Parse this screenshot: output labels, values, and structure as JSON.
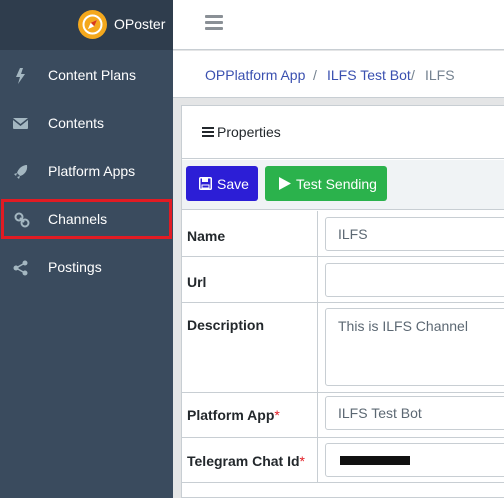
{
  "app": {
    "name": "OPoster"
  },
  "sidebar": {
    "items": [
      {
        "label": "Content Plans",
        "icon": "bolt-icon"
      },
      {
        "label": "Contents",
        "icon": "envelope-icon"
      },
      {
        "label": "Platform Apps",
        "icon": "rocket-icon"
      },
      {
        "label": "Channels",
        "icon": "link-icon"
      },
      {
        "label": "Postings",
        "icon": "share-icon"
      }
    ],
    "highlight_color": "#e21b23"
  },
  "breadcrumb": {
    "items": [
      "OPPlatform App",
      "ILFS Test Bot"
    ],
    "current": "ILFS",
    "separator": "/"
  },
  "card": {
    "header": "Properties",
    "buttons": {
      "save": "Save",
      "test": "Test Sending"
    },
    "fields": {
      "name": {
        "label": "Name",
        "value": "ILFS"
      },
      "url": {
        "label": "Url",
        "value": ""
      },
      "description": {
        "label": "Description",
        "value": "This is ILFS Channel"
      },
      "platform_app": {
        "label": "Platform App",
        "value": "ILFS Test Bot",
        "required": "*"
      },
      "telegram_chat_id": {
        "label": "Telegram Chat Id",
        "value": "",
        "required": "*"
      }
    }
  },
  "colors": {
    "sidebar_bg": "#3a4b5e",
    "brand_bg": "#2f3d4d",
    "save_button": "#2c1ed6",
    "test_button": "#2bb24c",
    "link": "#3a50b0"
  }
}
